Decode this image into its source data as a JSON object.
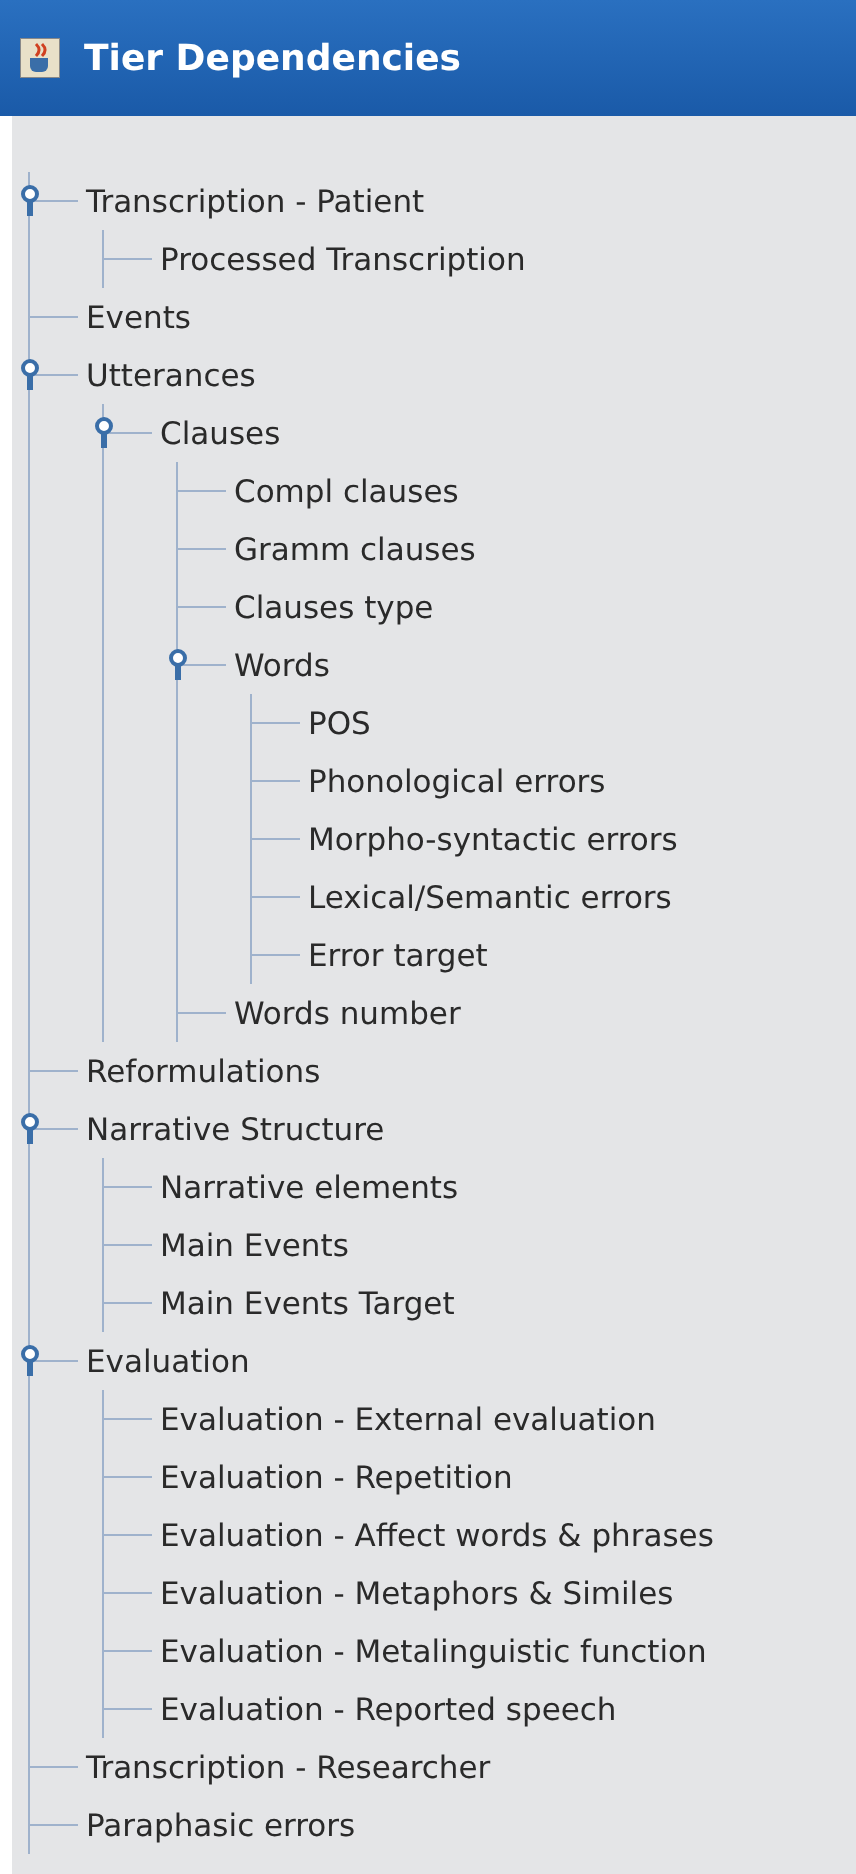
{
  "window": {
    "title": "Tier Dependencies"
  },
  "tree": [
    {
      "label": "Transcription - Patient",
      "expanded": true,
      "children": [
        {
          "label": "Processed Transcription"
        }
      ]
    },
    {
      "label": "Events"
    },
    {
      "label": "Utterances",
      "expanded": true,
      "children": [
        {
          "label": "Clauses",
          "expanded": true,
          "children": [
            {
              "label": "Compl clauses"
            },
            {
              "label": "Gramm clauses"
            },
            {
              "label": "Clauses type"
            },
            {
              "label": "Words",
              "expanded": true,
              "children": [
                {
                  "label": "POS"
                },
                {
                  "label": "Phonological errors"
                },
                {
                  "label": "Morpho-syntactic errors"
                },
                {
                  "label": "Lexical/Semantic errors"
                },
                {
                  "label": "Error target"
                }
              ]
            },
            {
              "label": "Words number"
            }
          ]
        }
      ]
    },
    {
      "label": "Reformulations"
    },
    {
      "label": "Narrative Structure",
      "expanded": true,
      "children": [
        {
          "label": "Narrative elements"
        },
        {
          "label": "Main Events"
        },
        {
          "label": "Main Events Target"
        }
      ]
    },
    {
      "label": "Evaluation",
      "expanded": true,
      "children": [
        {
          "label": "Evaluation - External evaluation"
        },
        {
          "label": "Evaluation - Repetition"
        },
        {
          "label": "Evaluation - Affect words & phrases"
        },
        {
          "label": "Evaluation - Metaphors & Similes"
        },
        {
          "label": "Evaluation - Metalinguistic function"
        },
        {
          "label": "Evaluation - Reported speech"
        }
      ]
    },
    {
      "label": "Transcription - Researcher"
    },
    {
      "label": "Paraphasic errors"
    }
  ]
}
